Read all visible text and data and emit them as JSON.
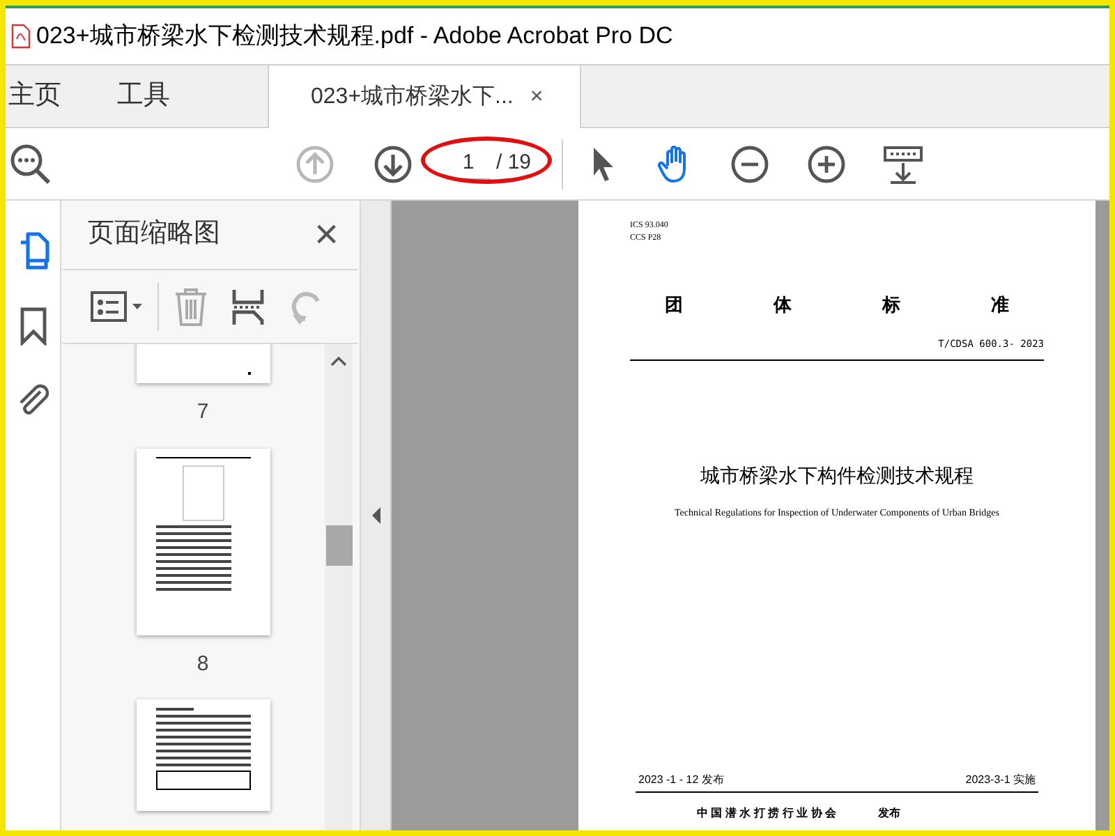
{
  "window": {
    "title": "023+城市桥梁水下检测技术规程.pdf - Adobe Acrobat Pro DC"
  },
  "tabs": [
    {
      "label": "主页",
      "kind": "nav",
      "selected": false
    },
    {
      "label": "工具",
      "kind": "nav",
      "selected": false
    },
    {
      "label": "023+城市桥梁水下...",
      "kind": "document",
      "selected": true,
      "close": "×"
    }
  ],
  "toolbar": {
    "nav_buttons": [
      {
        "kind": "up",
        "disabled": true
      },
      {
        "kind": "down",
        "disabled": false
      }
    ],
    "page_number": "1",
    "page_count": "/ 19",
    "tools": [
      {
        "kind": "pointer",
        "selected": false
      },
      {
        "kind": "hand",
        "selected": true
      }
    ]
  },
  "rail": [
    {
      "kind": "pages",
      "selected": true
    },
    {
      "kind": "bookmark",
      "selected": false
    },
    {
      "kind": "attachment",
      "selected": false
    }
  ],
  "sidebar": {
    "title": "页面缩略图",
    "close": "×",
    "thumbnails": [
      {
        "label": "7",
        "kind": "partial"
      },
      {
        "label": "8",
        "kind": "text"
      },
      {
        "kind": "table"
      }
    ]
  },
  "document": {
    "codes": [
      "ICS 93.040",
      "CCS P28"
    ],
    "heading": [
      "团",
      "体",
      "标",
      "准"
    ],
    "standard_number": "T/CDSA 600.3- 2023",
    "title": "城市桥梁水下构件检测技术规程",
    "subtitle": "Technical Regulations for Inspection of Underwater Components of Urban Bridges",
    "issued": "2023 -1 - 12 发布",
    "effective": "2023-3-1 实施",
    "publisher": "中 国 潜 水 打 捞 行 业 协 会",
    "publisher_action": "发布"
  }
}
